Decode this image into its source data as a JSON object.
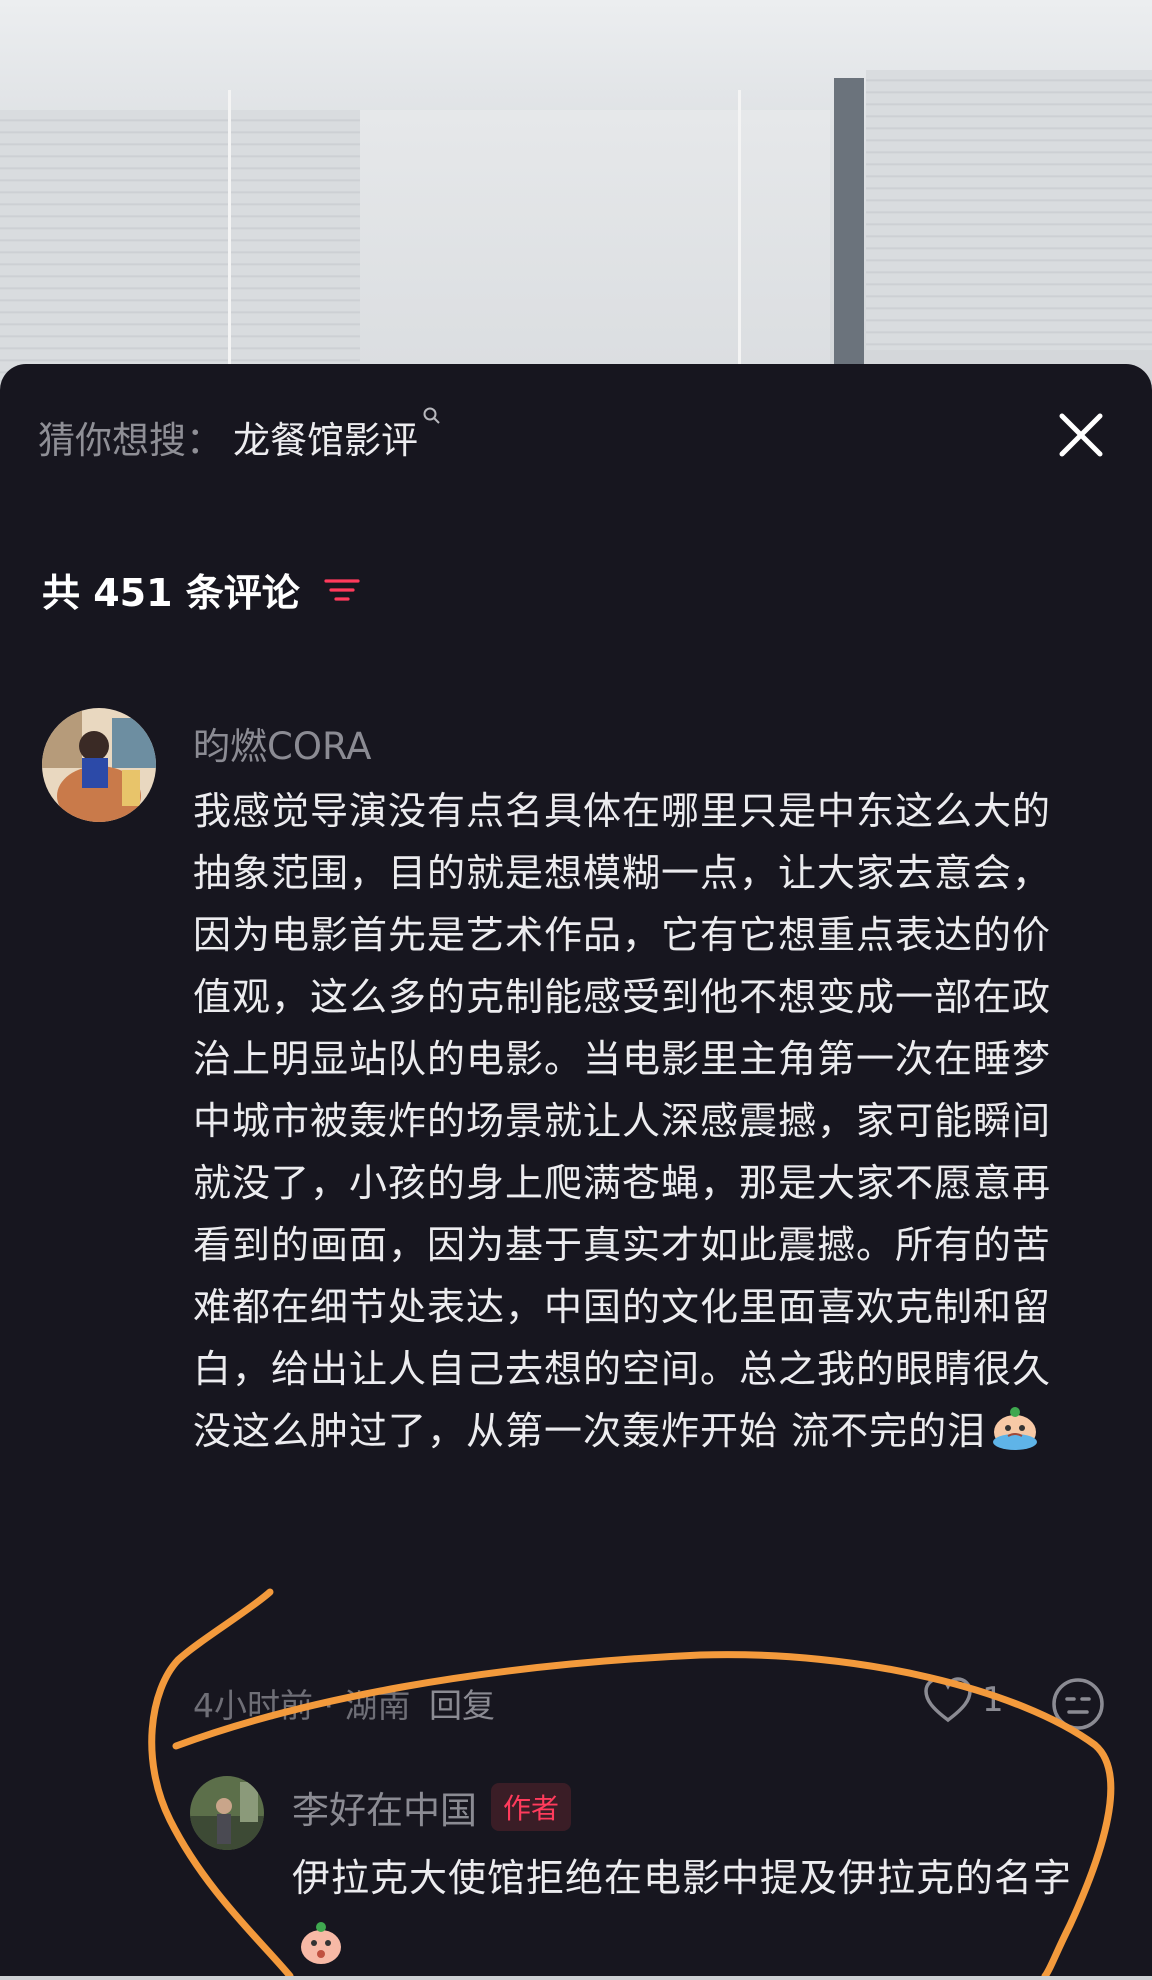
{
  "search_suggestion": {
    "prefix": "猜你想搜：",
    "term": "龙餐馆影评"
  },
  "comments_header": {
    "count_label": "共 451 条评论"
  },
  "comment": {
    "username": "昀燃CORA",
    "text": "我感觉导演没有点名具体在哪里只是中东这么大的抽象范围，目的就是想模糊一点，让大家去意会，因为电影首先是艺术作品，它有它想重点表达的价值观，这么多的克制能感受到他不想变成一部在政治上明显站队的电影。当电影里主角第一次在睡梦中城市被轰炸的场景就让人深感震撼，家可能瞬间就没了，小孩的身上爬满苍蝇，那是大家不愿意再看到的画面，因为基于真实才如此震撼。所有的苦难都在细节处表达，中国的文化里面喜欢克制和留白，给出让人自己去想的空间。总之我的眼睛很久没这么肿过了，从第一次轰炸开始 流不完的泪",
    "time_location": "4小时前 · 湖南",
    "reply_label": "回复",
    "like_count": "1"
  },
  "reply": {
    "username": "李好在中国",
    "badge": "作者",
    "text": "伊拉克大使馆拒绝在电影中提及伊拉克的名字"
  },
  "icons": {
    "close": "close-icon",
    "filter": "filter-icon",
    "like": "heart-icon",
    "emoji": "emoji-icon"
  },
  "colors": {
    "sheet_bg": "#17161f",
    "accent": "#ff3b5c",
    "annotation": "#f39a3c"
  }
}
